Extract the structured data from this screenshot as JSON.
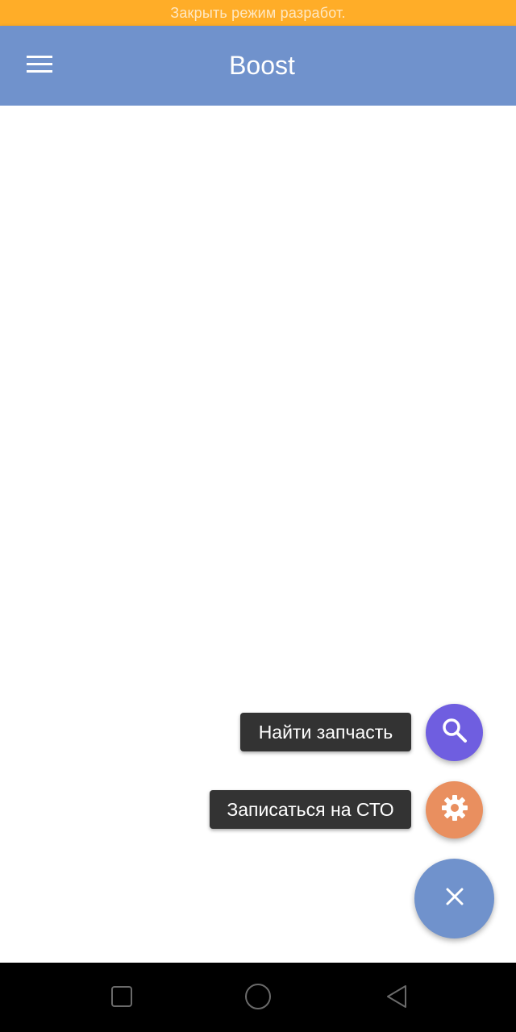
{
  "dev_banner": {
    "text": "Закрыть режим разработ."
  },
  "app_bar": {
    "title": "Boost",
    "menu_icon": "hamburger-menu-icon",
    "color": "#7092cc"
  },
  "fab_menu": {
    "actions": [
      {
        "label": "Найти запчасть",
        "icon": "search-icon",
        "color": "#6f5ee0"
      },
      {
        "label": "Записаться на СТО",
        "icon": "gear-icon",
        "color": "#e98f5f"
      }
    ],
    "main_button": {
      "icon": "close-icon",
      "color": "#7092cc"
    }
  },
  "system_nav": {
    "buttons": [
      "recent-apps-icon",
      "home-icon",
      "back-icon"
    ]
  },
  "colors": {
    "banner": "#ffad28",
    "primary": "#7092cc"
  }
}
